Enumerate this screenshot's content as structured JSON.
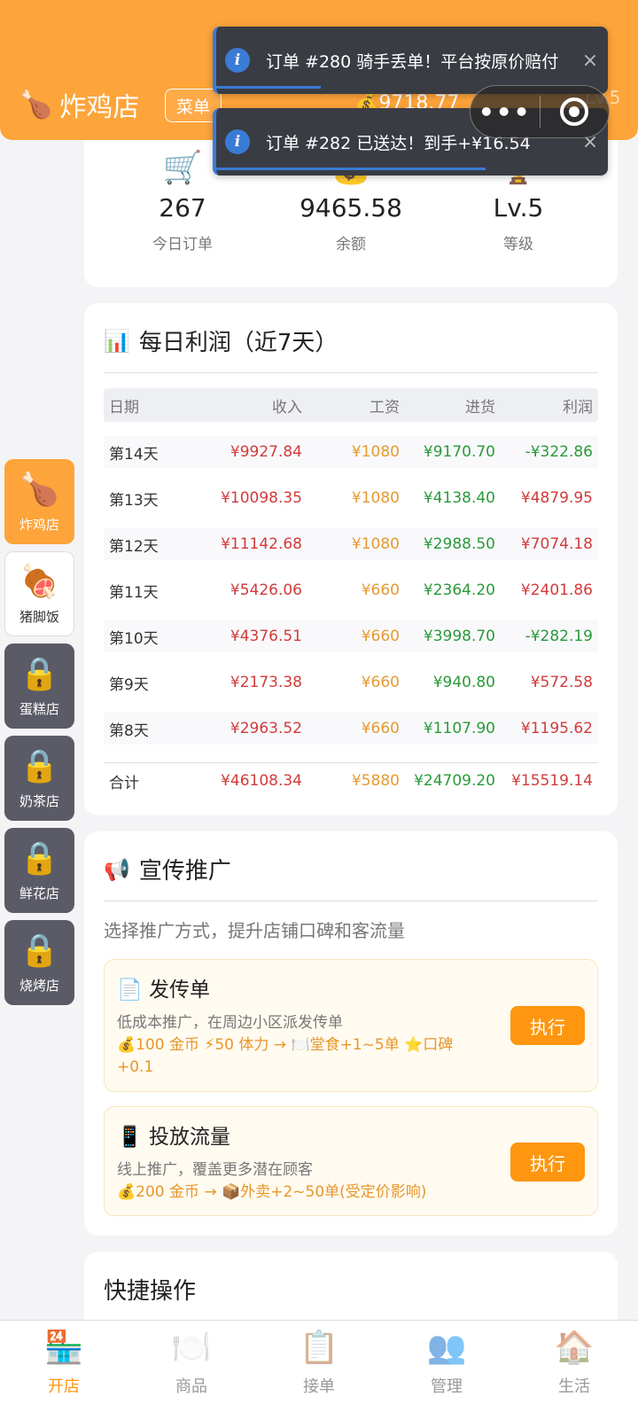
{
  "header": {
    "shop_emoji": "🍗",
    "shop_name": "炸鸡店",
    "menu_label": "菜单",
    "balance": "💰9718.77",
    "level": "Lv.5"
  },
  "capsule": {
    "more": "•••"
  },
  "toasts": [
    {
      "icon": "i",
      "text": "订单 #280 骑手丢单！平台按原价赔付",
      "close": "×"
    },
    {
      "icon": "i",
      "text": "订单 #282 已送达！到手+¥16.54",
      "close": "×"
    }
  ],
  "stats": [
    {
      "icon": "🛒",
      "value": "267",
      "label": "今日订单"
    },
    {
      "icon": "💰",
      "value": "9465.58",
      "label": "余额"
    },
    {
      "icon": "🏆",
      "value": "Lv.5",
      "label": "等级"
    }
  ],
  "profit": {
    "icon": "📊",
    "title": "每日利润（近7天）",
    "headers": [
      "日期",
      "收入",
      "工资",
      "进货",
      "利润"
    ],
    "rows": [
      [
        "第14天",
        "¥9927.84",
        "¥1080",
        "¥9170.70",
        "-¥322.86"
      ],
      [
        "第13天",
        "¥10098.35",
        "¥1080",
        "¥4138.40",
        "¥4879.95"
      ],
      [
        "第12天",
        "¥11142.68",
        "¥1080",
        "¥2988.50",
        "¥7074.18"
      ],
      [
        "第11天",
        "¥5426.06",
        "¥660",
        "¥2364.20",
        "¥2401.86"
      ],
      [
        "第10天",
        "¥4376.51",
        "¥660",
        "¥3998.70",
        "-¥282.19"
      ],
      [
        "第9天",
        "¥2173.38",
        "¥660",
        "¥940.80",
        "¥572.58"
      ],
      [
        "第8天",
        "¥2963.52",
        "¥660",
        "¥1107.90",
        "¥1195.62"
      ]
    ],
    "total": [
      "合计",
      "¥46108.34",
      "¥5880",
      "¥24709.20",
      "¥15519.14"
    ]
  },
  "promo": {
    "icon": "📢",
    "title": "宣传推广",
    "desc": "选择推广方式，提升店铺口碑和客流量",
    "items": [
      {
        "icon": "📄",
        "title": "发传单",
        "desc": "低成本推广，在周边小区派发传单",
        "cost": "💰100 金币 ⚡50 体力 → 🍽️堂食+1~5单 ⭐口碑+0.1",
        "button": "执行"
      },
      {
        "icon": "📱",
        "title": "投放流量",
        "desc": "线上推广，覆盖更多潜在顾客",
        "cost": "💰200 金币 → 📦外卖+2~50单(受定价影响)",
        "button": "执行"
      }
    ]
  },
  "quick": {
    "title": "快捷操作"
  },
  "sidebar": [
    {
      "icon": "🍗",
      "label": "炸鸡店",
      "state": "active"
    },
    {
      "icon": "🍖",
      "label": "猪脚饭",
      "state": "normal"
    },
    {
      "icon": "🔒",
      "label": "蛋糕店",
      "state": "locked"
    },
    {
      "icon": "🔒",
      "label": "奶茶店",
      "state": "locked"
    },
    {
      "icon": "🔒",
      "label": "鲜花店",
      "state": "locked"
    },
    {
      "icon": "🔒",
      "label": "烧烤店",
      "state": "locked"
    }
  ],
  "tabs": [
    {
      "icon": "🏪",
      "label": "开店",
      "active": true
    },
    {
      "icon": "🍽️",
      "label": "商品",
      "active": false
    },
    {
      "icon": "📋",
      "label": "接单",
      "active": false
    },
    {
      "icon": "👥",
      "label": "管理",
      "active": false
    },
    {
      "icon": "🏠",
      "label": "生活",
      "active": false
    }
  ]
}
